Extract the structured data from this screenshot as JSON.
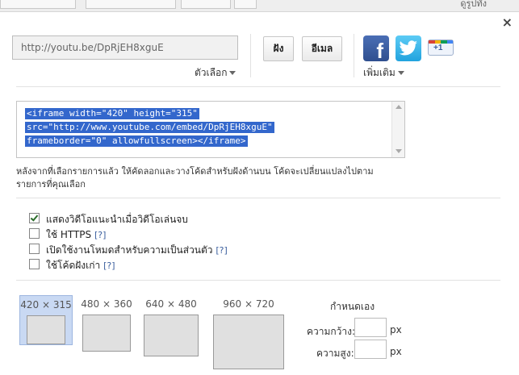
{
  "top": {
    "partial_text": "ดูรูปทั้ง"
  },
  "close": {
    "glyph": "×"
  },
  "share": {
    "url_value": "http://youtu.be/DpRjEH8xguE",
    "options_label": "ตัวเลือก",
    "embed_button": "ฝัง",
    "email_button": "อีเมล",
    "more_label": "เพิ่มเติม",
    "facebook_glyph": "f",
    "gplus_label": "+1"
  },
  "embed_code": {
    "lines": [
      "<iframe width=\"420\" height=\"315\"",
      "src=\"http://www.youtube.com/embed/DpRjEH8xguE\"",
      "frameborder=\"0\" allowfullscreen></iframe>"
    ]
  },
  "note": "หลังจากที่เลือกรายการแล้ว ให้คัดลอกและวางโค้ดสำหรับฝังด้านบน โค้ดจะเปลี่ยนแปลงไปตามรายการที่คุณเลือก",
  "options": [
    {
      "label": "แสดงวิดีโอแนะนำเมื่อวิดีโอเล่นจบ",
      "checked": true,
      "help": ""
    },
    {
      "label": "ใช้ HTTPS",
      "checked": false,
      "help": "[?]"
    },
    {
      "label": "เปิดใช้งานโหมดสำหรับความเป็นส่วนตัว",
      "checked": false,
      "help": "[?]"
    },
    {
      "label": "ใช้โค้ดฝังเก่า",
      "checked": false,
      "help": "[?]"
    }
  ],
  "sizes": [
    {
      "label": "420 × 315",
      "selected": true
    },
    {
      "label": "480 × 360",
      "selected": false
    },
    {
      "label": "640 × 480",
      "selected": false
    },
    {
      "label": "960 × 720",
      "selected": false
    }
  ],
  "custom": {
    "title": "กำหนดเอง",
    "width_label": "ความกว้าง:",
    "height_label": "ความสูง:",
    "unit": "px",
    "width_value": "",
    "height_value": ""
  },
  "colors": {
    "selection": "#3367cc",
    "selected_size_bg": "#c9d9f3",
    "facebook": "#3b5998",
    "twitter": "#33b6ea"
  }
}
